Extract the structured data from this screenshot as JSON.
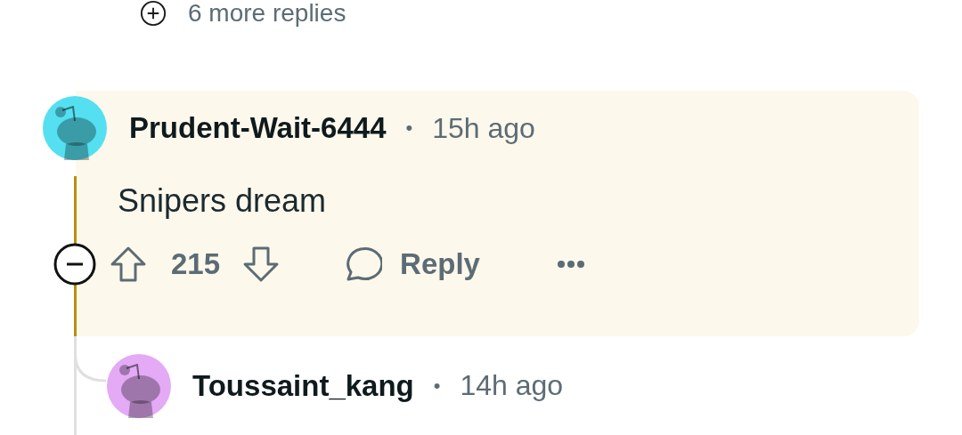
{
  "more_replies": {
    "label": "6 more replies"
  },
  "comments": [
    {
      "author": "Prudent-Wait-6444",
      "time": "15h ago",
      "separator": "•",
      "body": "Snipers dream",
      "highlighted": true,
      "expanded": true,
      "votes": "215",
      "reply_label": "Reply",
      "color": "#54e0f0"
    },
    {
      "author": "Toussaint_kang",
      "time": "14h ago",
      "separator": "•",
      "color": "#e4aaf5"
    }
  ]
}
